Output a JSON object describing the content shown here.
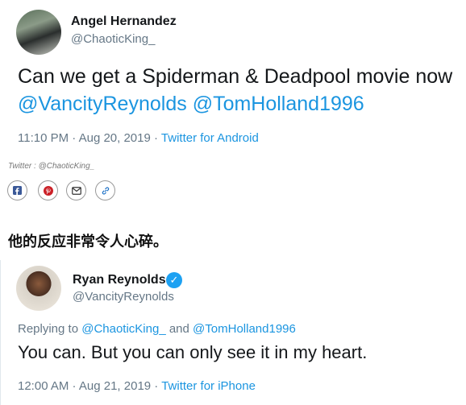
{
  "tweet1": {
    "display_name": "Angel Hernandez",
    "handle": "@ChaoticKing_",
    "text_prefix": "Can we get a Spiderman & Deadpool movie now",
    "mention1": "@VancityReynolds",
    "mention2": "@TomHolland1996",
    "time": "11:10 PM · Aug 20, 2019 · ",
    "source": "Twitter for Android"
  },
  "source_credit": "Twitter : @ChaoticKing_",
  "share_icons": [
    "facebook-icon",
    "pinterest-icon",
    "mail-icon",
    "link-icon"
  ],
  "caption": "他的反应非常令人心碎。",
  "tweet2": {
    "display_name": "Ryan Reynolds",
    "handle": "@VancityReynolds",
    "reply_prefix": "Replying to ",
    "reply_mention1": "@ChaoticKing_",
    "reply_and": " and ",
    "reply_mention2": "@TomHolland1996",
    "text": "You can. But you can only see it in my heart.",
    "time": "12:00 AM · Aug 21, 2019 · ",
    "source": "Twitter for iPhone"
  },
  "colors": {
    "link": "#1b95e0",
    "muted": "#657786",
    "verified": "#1da1f2"
  }
}
